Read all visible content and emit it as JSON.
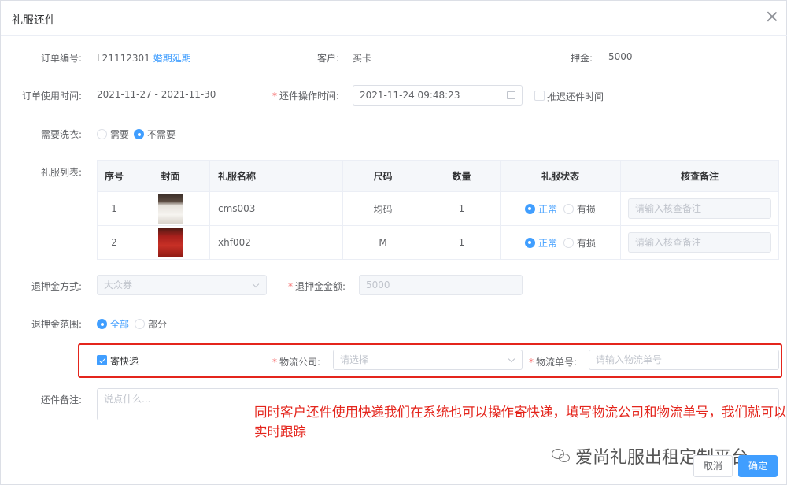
{
  "dialog": {
    "title": "礼服还件"
  },
  "order": {
    "no_label": "订单编号:",
    "no_value": "L21112301",
    "no_link": "婚期延期",
    "customer_label": "客户:",
    "customer_value": "买卡",
    "deposit_label": "押金:",
    "deposit_value": "5000",
    "use_time_label": "订单使用时间:",
    "use_time_value": "2021-11-27 - 2021-11-30",
    "return_time_label": "还件操作时间:",
    "return_time_value": "2021-11-24 09:48:23",
    "delay_label": "推迟还件时间"
  },
  "wash": {
    "label": "需要洗衣:",
    "options": [
      "需要",
      "不需要"
    ],
    "selected": "不需要"
  },
  "dress_list": {
    "label": "礼服列表:",
    "columns": [
      "序号",
      "封面",
      "礼服名称",
      "尺码",
      "数量",
      "礼服状态",
      "核查备注"
    ],
    "rows": [
      {
        "index": "1",
        "name": "cms003",
        "size": "均码",
        "qty": "1",
        "status_normal": "正常",
        "status_damaged": "有损",
        "note_placeholder": "请输入核查备注"
      },
      {
        "index": "2",
        "name": "xhf002",
        "size": "M",
        "qty": "1",
        "status_normal": "正常",
        "status_damaged": "有损",
        "note_placeholder": "请输入核查备注"
      }
    ]
  },
  "refund": {
    "method_label": "退押金方式:",
    "method_value": "大众券",
    "amount_label": "退押金金额:",
    "amount_value": "5000",
    "scope_label": "退押金范围:",
    "scope_options": [
      "全部",
      "部分"
    ],
    "scope_selected": "全部"
  },
  "express": {
    "checkbox_label": "寄快递",
    "company_label": "物流公司:",
    "company_placeholder": "请选择",
    "tracking_label": "物流单号:",
    "tracking_placeholder": "请输入物流单号"
  },
  "remark": {
    "label": "还件备注:",
    "placeholder": "说点什么..."
  },
  "annotation": "同时客户还件使用快递我们在系统也可以操作寄快递，填写物流公司和物流单号，我们就可以实时跟踪",
  "footer": {
    "cancel_label": "取消",
    "ok_label": "确定"
  },
  "watermark": "爱尚礼服出租定制平台",
  "colors": {
    "primary": "#409eff",
    "annotation_red": "#e4251c",
    "required": "#f56c6c"
  }
}
